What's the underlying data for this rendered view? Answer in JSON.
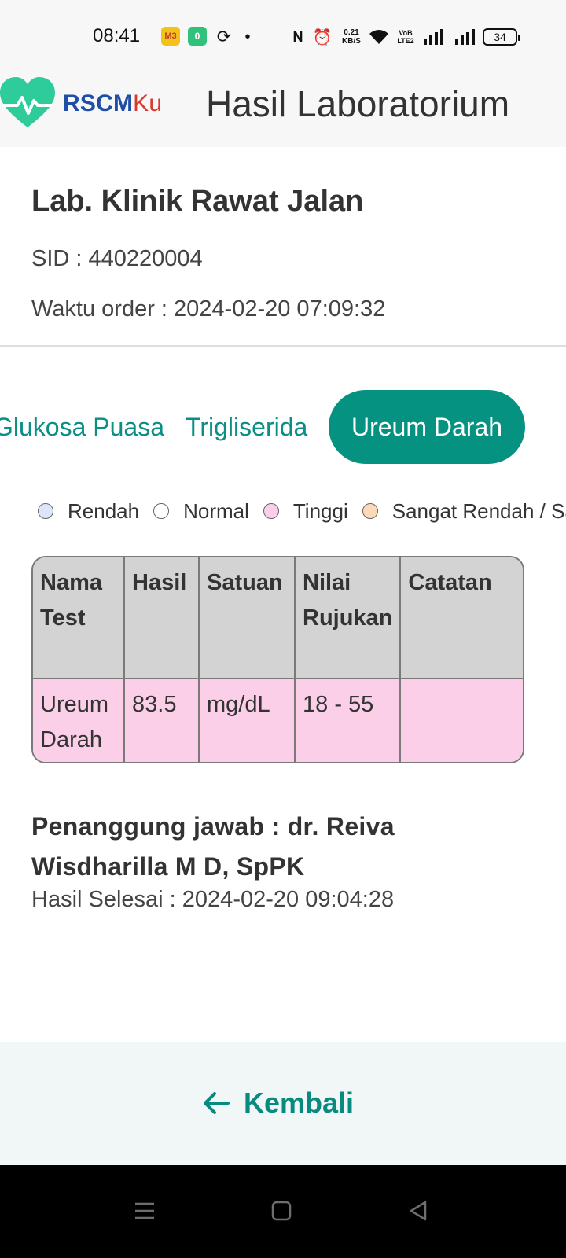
{
  "status_bar": {
    "time": "08:41",
    "app_icon_1": "M3",
    "app_icon_2": "0",
    "network_speed_value": "0.21",
    "network_speed_unit": "KB/S",
    "volte_top": "VoB",
    "volte_bottom": "LTE2",
    "battery": "34",
    "icons": [
      "app-notification-icon",
      "battery-app-icon",
      "sync-icon",
      "dot-icon",
      "nfc-icon",
      "alarm-icon",
      "wifi-icon",
      "signal-icon",
      "signal-icon",
      "battery-icon"
    ]
  },
  "header": {
    "brand_part1": "RSCM",
    "brand_part2": "Ku",
    "title": "Hasil Laboratorium",
    "colors": {
      "brand_blue": "#1e4ea8",
      "brand_red": "#d83a2d",
      "logo_green": "#2ecc9a"
    }
  },
  "info": {
    "lab_name": "Lab. Klinik Rawat Jalan",
    "sid": "SID : 440220004",
    "order_time": "Waktu order : 2024-02-20 07:09:32"
  },
  "tabs": [
    {
      "label": "Glukosa Puasa",
      "active": false
    },
    {
      "label": "Trigliserida",
      "active": false
    },
    {
      "label": "Ureum Darah",
      "active": true
    }
  ],
  "legend": [
    {
      "label": "Rendah",
      "color": "#dde5fa"
    },
    {
      "label": "Normal",
      "color": "#ffffff"
    },
    {
      "label": "Tinggi",
      "color": "#fccfe9"
    },
    {
      "label": "Sangat Rendah / Sangat Tinggi",
      "color": "#fcd9b8"
    }
  ],
  "table": {
    "headers": [
      "Nama Test",
      "Hasil",
      "Satuan",
      "Nilai Rujukan",
      "Catatan"
    ],
    "rows": [
      {
        "nama_test": "Ureum Darah",
        "hasil": "83.5",
        "satuan": "mg/dL",
        "nilai_rujukan": "18 - 55",
        "catatan": ""
      }
    ]
  },
  "footer": {
    "penanggung_jawab": "Penanggung jawab : dr. Reiva Wisdharilla M D, SpPK",
    "hasil_selesai": "Hasil Selesai : 2024-02-20 09:04:28"
  },
  "actions": {
    "back_label": "Kembali",
    "accent_color": "#069281"
  },
  "navigation": {
    "buttons": [
      "menu-icon",
      "home-icon",
      "back-icon"
    ]
  }
}
